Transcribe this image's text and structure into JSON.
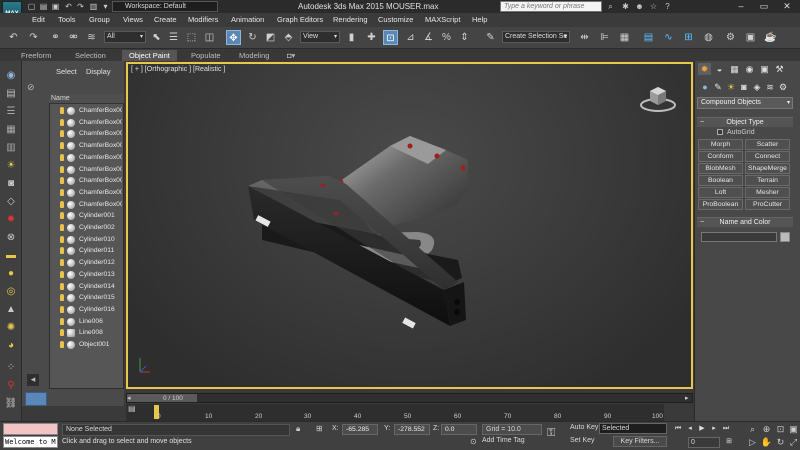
{
  "app": {
    "logo_text": "MAX",
    "title": "Autodesk 3ds Max  2015    MOUSER.max",
    "workspace": "Workspace: Default",
    "search_placeholder": "Type a keyword or phrase"
  },
  "menu": [
    "Edit",
    "Tools",
    "Group",
    "Views",
    "Create",
    "Modifiers",
    "Animation",
    "Graph Editors",
    "Rendering",
    "Customize",
    "MAXScript",
    "Help"
  ],
  "toolbar": {
    "selection_filter": "All",
    "reference_coord": "View",
    "named_selection": "Create Selection Se"
  },
  "ribbon_tabs": [
    "Freeform",
    "Selection",
    "Object Paint",
    "Populate",
    "Modeling"
  ],
  "explorer": {
    "tabs": [
      "Select",
      "Display"
    ],
    "column_header": "Name",
    "items": [
      "ChamferBox00",
      "ChamferBox00",
      "ChamferBox00",
      "ChamferBox00",
      "ChamferBox00",
      "ChamferBox00",
      "ChamferBox00",
      "ChamferBox00",
      "ChamferBox00",
      "Cylinder001",
      "Cylinder002",
      "Cylinder010",
      "Cylinder011",
      "Cylinder012",
      "Cylinder013",
      "Cylinder014",
      "Cylinder015",
      "Cylinder016",
      "Line006",
      "Line008",
      "Object001"
    ]
  },
  "viewport": {
    "label": "[ + ] [Orthographic ] [Realistic ]"
  },
  "timeline": {
    "slider_label": "0 / 100",
    "ticks": [
      "0",
      "10",
      "20",
      "30",
      "40",
      "50",
      "60",
      "70",
      "80",
      "90",
      "100"
    ]
  },
  "status": {
    "maxscript_output": "Welcome to M",
    "selection": "None Selected",
    "prompt": "Click and drag to select and move objects",
    "x_label": "X:",
    "x_value": "-65.285",
    "y_label": "Y:",
    "y_value": "-278.552",
    "z_label": "Z:",
    "z_value": "0.0",
    "grid": "Grid = 10.0",
    "add_time_tag": "Add Time Tag",
    "auto_key": "Auto Key",
    "set_key": "Set Key",
    "key_mode": "Selected",
    "key_filters": "Key Filters...",
    "frame": "0"
  },
  "command_panel": {
    "category": "Compound Objects",
    "object_type_title": "Object Type",
    "autogrid": "AutoGrid",
    "buttons": [
      "Morph",
      "Scatter",
      "Conform",
      "Connect",
      "BlobMesh",
      "ShapeMerge",
      "Boolean",
      "Terrain",
      "Loft",
      "Mesher",
      "ProBoolean",
      "ProCutter"
    ],
    "name_color_title": "Name and Color"
  },
  "colors": {
    "viewport_border": "#e8c84a",
    "active_tool": "#5a88b4",
    "swatch": "#bcbcbc"
  }
}
